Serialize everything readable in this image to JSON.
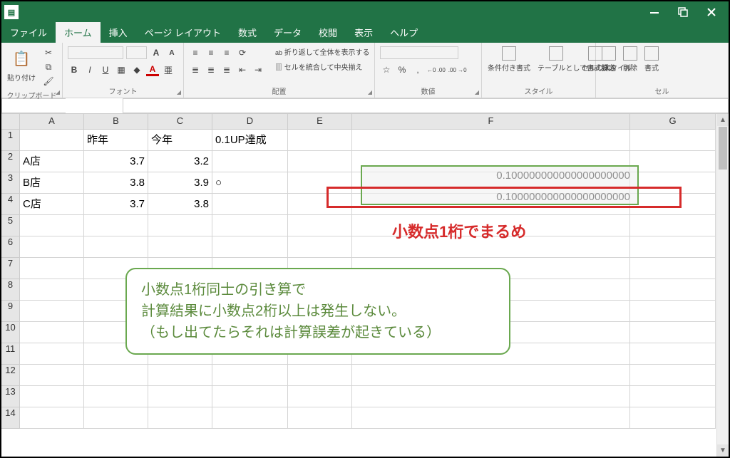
{
  "titlebar": {
    "app_icon": "▤"
  },
  "tabs": {
    "file": "ファイル",
    "home": "ホーム",
    "insert": "挿入",
    "page": "ページ レイアウト",
    "formula": "数式",
    "data": "データ",
    "review": "校閲",
    "view": "表示",
    "help": "ヘルプ"
  },
  "ribbon": {
    "paste": "貼り付け",
    "clipboard": "クリップボード",
    "font": "フォント",
    "bold": "B",
    "italic": "I",
    "underline": "U",
    "align": "配置",
    "wrap": "折り返して全体を表示する",
    "merge": "セルを統合して中央揃え",
    "number": "数値",
    "percent": "%",
    "comma": ",",
    "dec_inc": "←0 .00",
    "dec_dec": ".00 →0",
    "cond_fmt": "条件付き書式",
    "table_fmt": "テーブルとして書式設定",
    "cell_style": "セルのスタイル",
    "styles": "スタイル",
    "ins": "挿入",
    "del": "削除",
    "fmt": "書式",
    "cells": "セル"
  },
  "columns": [
    "A",
    "B",
    "C",
    "D",
    "E",
    "F",
    "G"
  ],
  "rows": {
    "r1": {
      "B": "昨年",
      "C": "今年",
      "D": "0.1UP達成"
    },
    "r2": {
      "A": "A店",
      "B": "3.7",
      "C": "3.2",
      "D": ""
    },
    "r3": {
      "A": "B店",
      "B": "3.8",
      "C": "3.9",
      "D": "○"
    },
    "r4": {
      "A": "C店",
      "B": "3.7",
      "C": "3.8",
      "D": ""
    }
  },
  "f_values": {
    "F3": "0.100000000000000000000",
    "F4": "0.100000000000000000000"
  },
  "annotation": {
    "red_label": "小数点1桁でまるめ",
    "callout_l1": "小数点1桁同士の引き算で",
    "callout_l2": "計算結果に小数点2桁以上は発生しない。",
    "callout_l3": "（もし出てたらそれは計算誤差が起きている）"
  }
}
